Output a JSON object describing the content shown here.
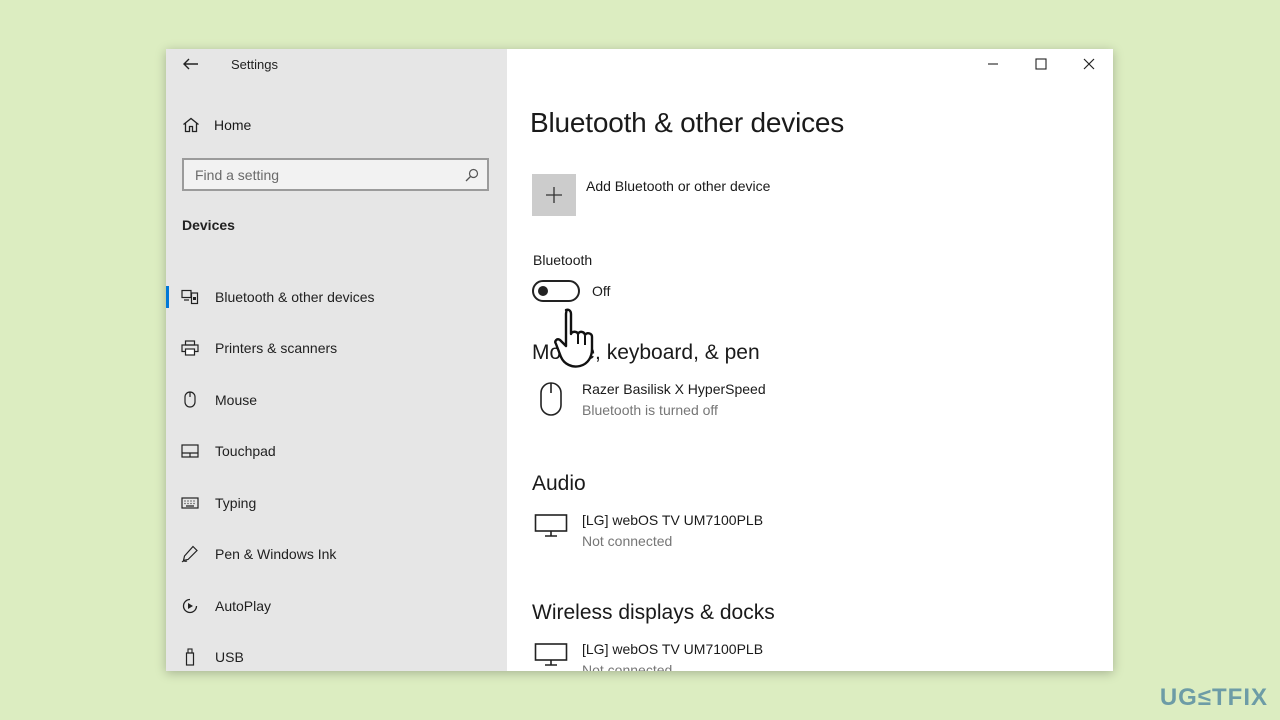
{
  "window": {
    "title": "Settings"
  },
  "sidebar": {
    "home_label": "Home",
    "search_placeholder": "Find a setting",
    "section_label": "Devices",
    "items": [
      {
        "label": "Bluetooth & other devices",
        "icon": "bluetooth-devices-icon",
        "selected": true
      },
      {
        "label": "Printers & scanners",
        "icon": "printer-icon",
        "selected": false
      },
      {
        "label": "Mouse",
        "icon": "mouse-icon",
        "selected": false
      },
      {
        "label": "Touchpad",
        "icon": "touchpad-icon",
        "selected": false
      },
      {
        "label": "Typing",
        "icon": "keyboard-icon",
        "selected": false
      },
      {
        "label": "Pen & Windows Ink",
        "icon": "pen-icon",
        "selected": false
      },
      {
        "label": "AutoPlay",
        "icon": "autoplay-icon",
        "selected": false
      },
      {
        "label": "USB",
        "icon": "usb-icon",
        "selected": false
      }
    ]
  },
  "main": {
    "page_title": "Bluetooth & other devices",
    "add_device_label": "Add Bluetooth or other device",
    "bluetooth_label": "Bluetooth",
    "bluetooth_state": "Off",
    "groups": [
      {
        "title": "Mouse, keyboard, & pen",
        "devices": [
          {
            "name": "Razer Basilisk X HyperSpeed",
            "status": "Bluetooth is turned off",
            "icon": "mouse-icon"
          }
        ]
      },
      {
        "title": "Audio",
        "devices": [
          {
            "name": "[LG] webOS TV UM7100PLB",
            "status": "Not connected",
            "icon": "monitor-icon"
          }
        ]
      },
      {
        "title": "Wireless displays & docks",
        "devices": [
          {
            "name": "[LG] webOS TV UM7100PLB",
            "status": "Not connected",
            "icon": "monitor-icon"
          }
        ]
      }
    ]
  },
  "watermark": "UG≤TFIX",
  "colors": {
    "background": "#dcedc1",
    "sidebar": "#e6e6e6",
    "accent": "#0078d7"
  }
}
